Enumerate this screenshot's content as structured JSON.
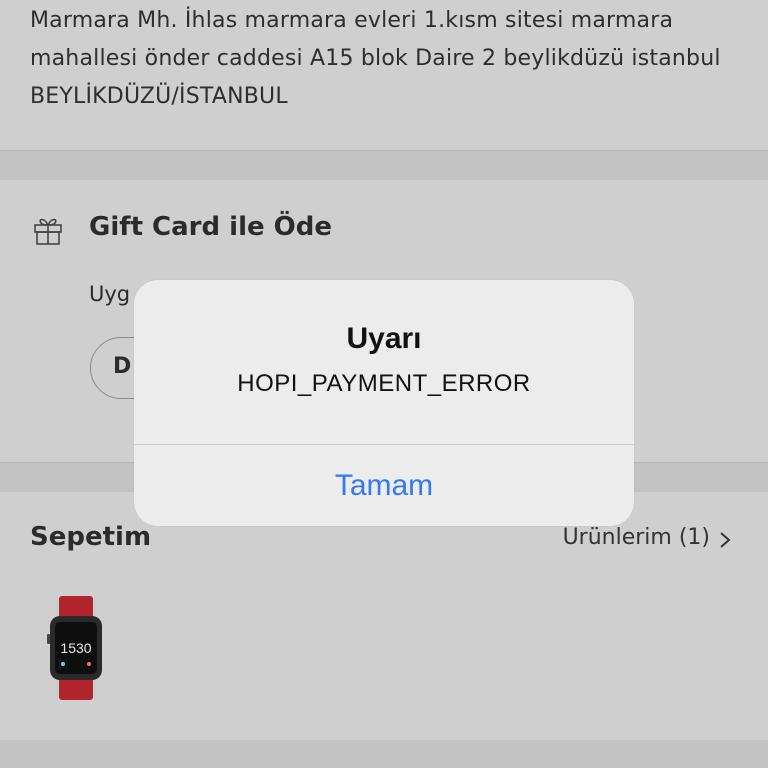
{
  "address": {
    "text": "Marmara Mh. İhlas marmara evleri 1.kısm sitesi marmara mahallesi önder caddesi A15 blok Daire 2 beylikdüzü istanbul BEYLİKDÜZÜ/İSTANBUL"
  },
  "gift_card": {
    "icon": "gift-icon",
    "title": "Gift Card ile Öde",
    "subtitle_partial": "Uyg",
    "button_partial": "D"
  },
  "basket": {
    "title": "Sepetim",
    "products_link": "Ürünlerim (1)",
    "chevron_icon": "chevron-right-icon",
    "product_image": "smartwatch",
    "watch_time": "1530"
  },
  "alert": {
    "title": "Uyarı",
    "message": "HOPI_PAYMENT_ERROR",
    "ok_button": "Tamam"
  },
  "colors": {
    "overlay_bg": "#c7c7c7",
    "alert_bg": "#ececec",
    "link_blue": "#3478f6",
    "watch_strap": "#b0242c"
  }
}
